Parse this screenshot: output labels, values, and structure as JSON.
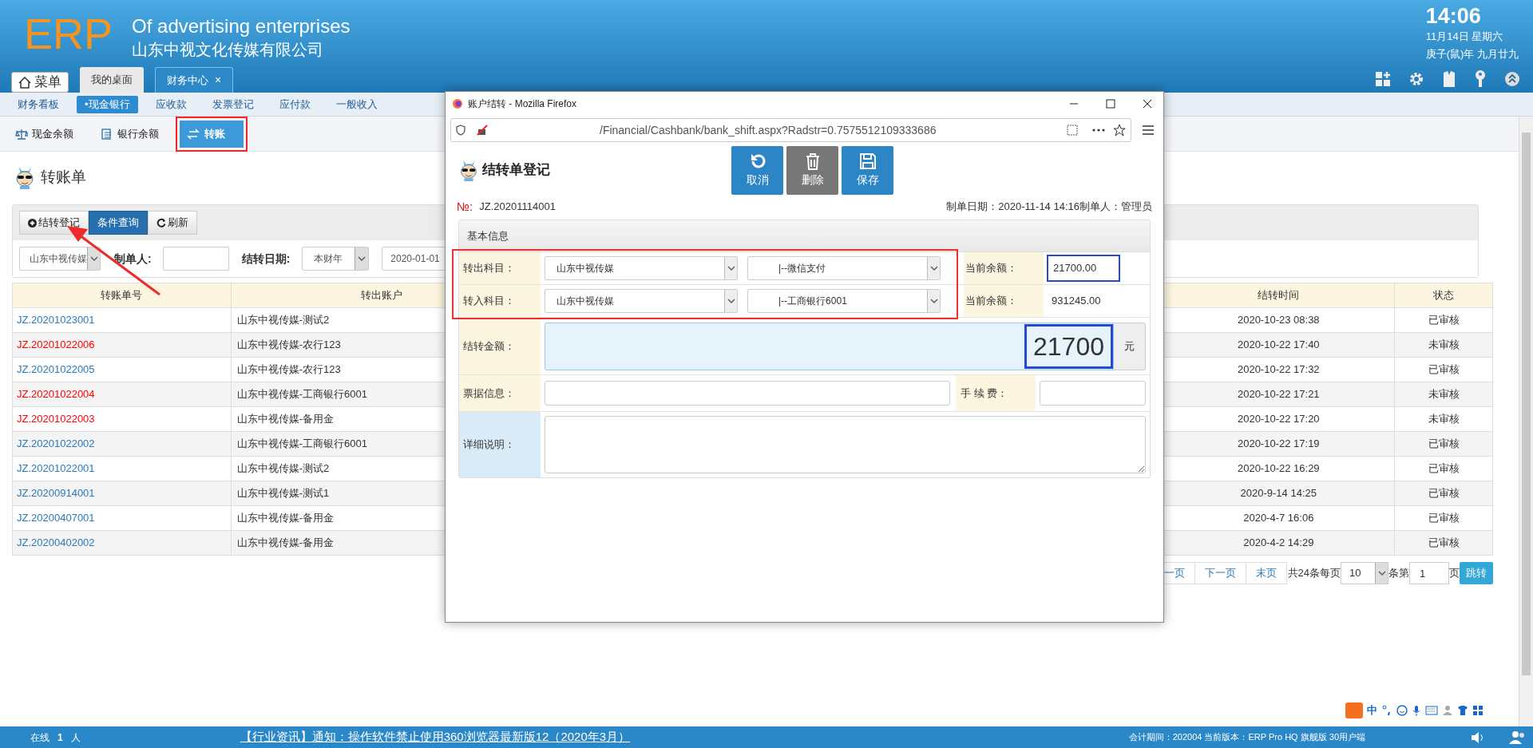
{
  "header": {
    "logo": "ERP",
    "tagline": "Of advertising enterprises",
    "company": "山东中视文化传媒有限公司",
    "clock": {
      "time": "14:06",
      "date": "11月14日 星期六",
      "lunar": "庚子(鼠)年 九月廿九"
    }
  },
  "menu_button": "菜单",
  "tabs": [
    {
      "label": "我的桌面",
      "selected": false
    },
    {
      "label": "财务中心",
      "selected": true,
      "close": "×"
    }
  ],
  "nav": [
    {
      "label": "财务看板",
      "selected": false
    },
    {
      "label": "•现金银行",
      "selected": true
    },
    {
      "label": "应收款",
      "selected": false
    },
    {
      "label": "发票登记",
      "selected": false
    },
    {
      "label": "应付款",
      "selected": false
    },
    {
      "label": "一般收入",
      "selected": false
    }
  ],
  "subtabs": [
    {
      "label": "现金余额",
      "selected": false
    },
    {
      "label": "银行余额",
      "selected": false
    },
    {
      "label": "转账",
      "selected": true
    }
  ],
  "annotations": {
    "selected_subtab_frame": true,
    "arrow": true
  },
  "page_title": "转账单",
  "toolbar": [
    {
      "label": "结转登记",
      "selected": false
    },
    {
      "label": "条件查询",
      "selected": true
    },
    {
      "label": "刷新",
      "selected": false
    }
  ],
  "filters": {
    "company": "山东中视传媒",
    "maker_label": "制单人:",
    "date_label": "结转日期:",
    "period": "本财年",
    "date_from": "2020-01-01"
  },
  "table": {
    "columns": [
      "转账单号",
      "转出账户",
      "结转时间",
      "状态"
    ],
    "rows": [
      {
        "id": "JZ.20201023001",
        "color": "#2a7ab8",
        "account": "山东中视传媒-测试2",
        "time": "2020-10-23 08:38",
        "status": "已审核"
      },
      {
        "id": "JZ.20201022006",
        "color": "#ff0000",
        "account": "山东中视传媒-农行123",
        "time": "2020-10-22 17:40",
        "status": "未审核"
      },
      {
        "id": "JZ.20201022005",
        "color": "#2a7ab8",
        "account": "山东中视传媒-农行123",
        "time": "2020-10-22 17:32",
        "status": "已审核"
      },
      {
        "id": "JZ.20201022004",
        "color": "#ff0000",
        "account": "山东中视传媒-工商银行6001",
        "time": "2020-10-22 17:21",
        "status": "未审核"
      },
      {
        "id": "JZ.20201022003",
        "color": "#ff0000",
        "account": "山东中视传媒-备用金",
        "time": "2020-10-22 17:20",
        "status": "未审核"
      },
      {
        "id": "JZ.20201022002",
        "color": "#2a7ab8",
        "account": "山东中视传媒-工商银行6001",
        "time": "2020-10-22 17:19",
        "status": "已审核"
      },
      {
        "id": "JZ.20201022001",
        "color": "#2a7ab8",
        "account": "山东中视传媒-测试2",
        "time": "2020-10-22 16:29",
        "status": "已审核"
      },
      {
        "id": "JZ.20200914001",
        "color": "#2a7ab8",
        "account": "山东中视传媒-测试1",
        "time": "2020-9-14 14:25",
        "status": "已审核"
      },
      {
        "id": "JZ.20200407001",
        "color": "#2a7ab8",
        "account": "山东中视传媒-备用金",
        "time": "2020-4-7 16:06",
        "status": "已审核"
      },
      {
        "id": "JZ.20200402002",
        "color": "#2a7ab8",
        "account": "山东中视传媒-备用金",
        "time": "2020-4-2 14:29",
        "status": "已审核"
      }
    ]
  },
  "pagination": {
    "prev": "一页",
    "next": "下一页",
    "last": "末页",
    "total_text": "共24条每页",
    "page_size": "10",
    "per_text": "条第",
    "page": "1",
    "page_text": "页",
    "go": "跳转"
  },
  "dialog": {
    "title": "账户结转 - Mozilla Firefox",
    "url": "/Financial/Cashbank/bank_shift.aspx?Radstr=0.7575512109333686",
    "heading": "结转单登记",
    "buttons": [
      {
        "label": "取消",
        "kind": "cancel"
      },
      {
        "label": "删除",
        "kind": "delete"
      },
      {
        "label": "保存",
        "kind": "save"
      }
    ],
    "number_label": "№:",
    "number": "JZ.20201114001",
    "meta": "制单日期：2020-11-14 14:16制单人：管理员",
    "section": "基本信息",
    "transfer_annotated": true,
    "transfer_rows": [
      {
        "label": "转出科目：",
        "company": "山东中视传媒",
        "account": "|--微信支付",
        "balance_label": "当前余额：",
        "balance": "21700.00",
        "balance_annotated": true
      },
      {
        "label": "转入科目：",
        "company": "山东中视传媒",
        "account": "|--工商银行6001",
        "balance_label": "当前余额：",
        "balance": "931245.00",
        "balance_annotated": false
      }
    ],
    "amount_label": "结转金额：",
    "amount": "21700",
    "amount_annotated": true,
    "unit": "元",
    "bill_label": "票据信息：",
    "fee_label": "手 续 费：",
    "note_label": "详细说明："
  },
  "ime_bar": {
    "mode": "中"
  },
  "status_bar": {
    "online_label": "在线",
    "online_count": "1",
    "online_unit": "人",
    "notice": "【行业资讯】通知：操作软件禁止使用360浏览器最新版12（2020年3月）",
    "version": "会计期间：202004 当前版本：ERP Pro HQ 旗舰版 30用户端"
  }
}
